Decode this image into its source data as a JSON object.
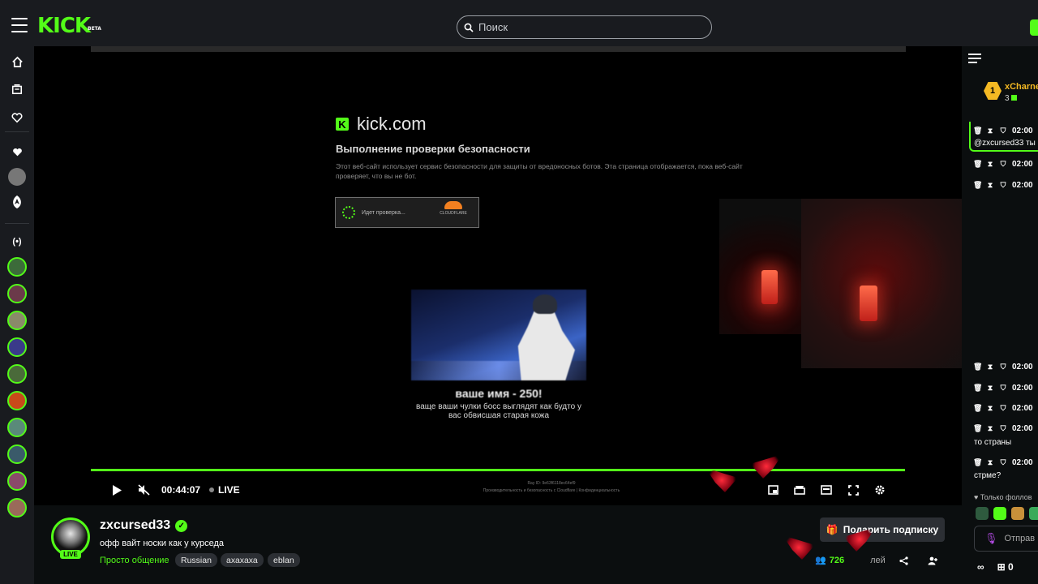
{
  "topbar": {
    "logo": "KICK",
    "logo_badge": "BETA",
    "search_placeholder": "Поиск"
  },
  "sidebar": {
    "icons": [
      "home-icon",
      "browse-icon",
      "following-icon",
      "heart-icon",
      "user-avatar-icon",
      "logo-icon",
      "live-icon"
    ],
    "channel_avatar_count": 10
  },
  "video": {
    "captcha": {
      "site": "kick.com",
      "heading": "Выполнение проверки безопасности",
      "body": "Этот веб-сайт использует сервис безопасности для защиты от вредоносных ботов. Эта страница отображается, пока веб-сайт проверяет, что вы не бот.",
      "widget_text": "Идет проверка...",
      "brand": "CLOUDFLARE",
      "ray_id": "Ray ID: 9e63f6118ec64ef9",
      "footer": "Производительность и безопасность с Cloudflare | Конфиденциальность"
    },
    "meme": {
      "title": "ваше имя - 250!",
      "subtitle": "ваще ваши чулки босс выглядят как будто у вас обвисшая старая кожа"
    },
    "controls": {
      "time": "00:44:07",
      "live_label": "LIVE",
      "progress_fraction": 1.0
    }
  },
  "chat": {
    "top_user": {
      "rank": "1",
      "name": "xCharne",
      "count": "3"
    },
    "messages": [
      {
        "time": "02:00",
        "text": "@zxcursed33 ты"
      },
      {
        "time": "02:00",
        "text": ""
      },
      {
        "time": "02:00",
        "text": ""
      },
      {
        "time": "02:00",
        "text": ""
      },
      {
        "time": "02:00",
        "text": ""
      },
      {
        "time": "02:00",
        "text": ""
      },
      {
        "time": "02:00",
        "text": "то страны"
      },
      {
        "time": "02:00",
        "text": "стрме?"
      }
    ],
    "followers_only": "Только фоллов",
    "input_placeholder": "Отправ",
    "bottom_count": "0"
  },
  "channel": {
    "name": "zxcursed33",
    "live_badge": "LIVE",
    "title": "офф вайт носки как у курседа",
    "category": "Просто общение",
    "tags": [
      "Russian",
      "ахахаха",
      "eblan"
    ],
    "subscribe_label": "Подарить подписку",
    "viewers": "726",
    "viewers_label": "лей"
  },
  "colors": {
    "accent": "#53fc18",
    "bg": "#0b0e0f",
    "panel": "#191b1f",
    "gold": "#f5b923"
  }
}
